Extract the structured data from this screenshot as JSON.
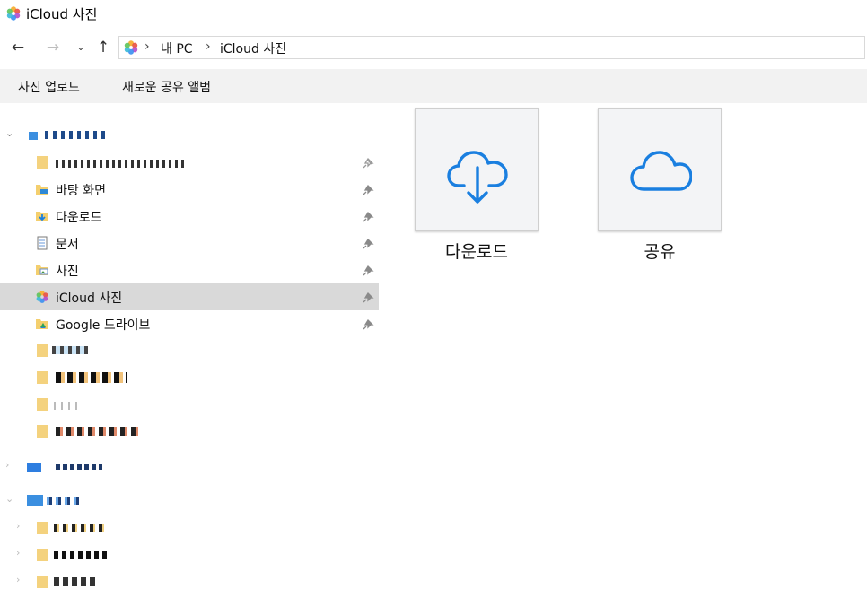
{
  "window": {
    "title": "iCloud 사진"
  },
  "address": {
    "crumbs": [
      "내 PC",
      "iCloud 사진"
    ]
  },
  "commands": [
    "사진 업로드",
    "새로운 공유 앨범"
  ],
  "nav": {
    "quick_access": [
      {
        "label": "바탕 화면"
      },
      {
        "label": "다운로드"
      },
      {
        "label": "문서"
      },
      {
        "label": "사진"
      },
      {
        "label": "iCloud 사진",
        "selected": true
      },
      {
        "label": "Google 드라이브"
      }
    ]
  },
  "content": {
    "tiles": [
      {
        "label": "다운로드",
        "icon": "cloud-download-icon"
      },
      {
        "label": "공유",
        "icon": "cloud-icon"
      }
    ]
  },
  "colors": {
    "accent": "#1a7fe0",
    "selection": "#d9d9d9",
    "command_bar": "#f2f2f2"
  }
}
